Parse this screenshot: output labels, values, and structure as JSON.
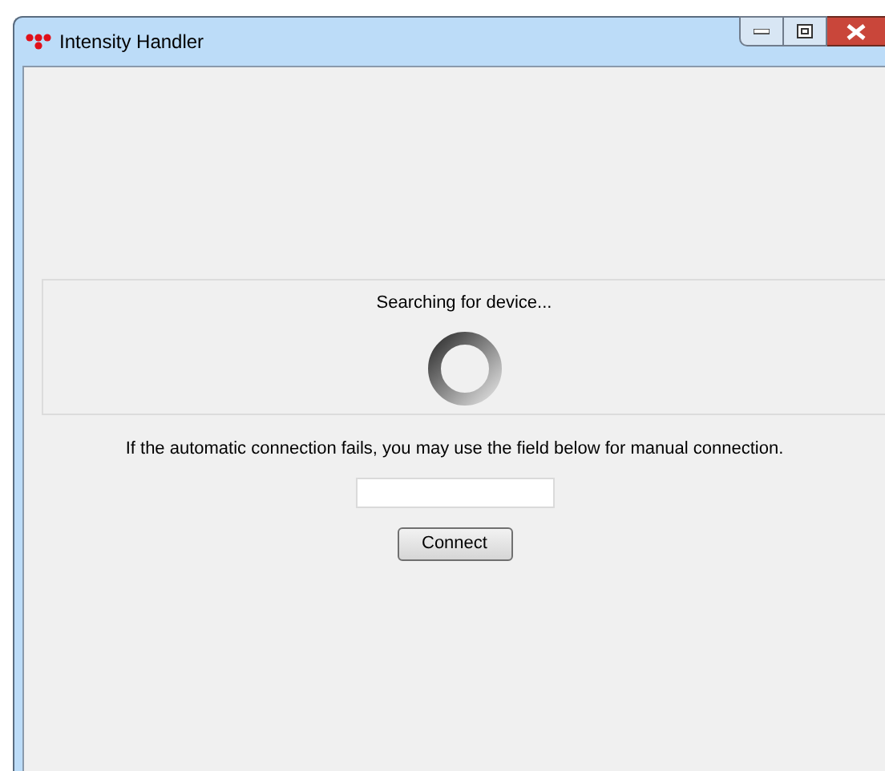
{
  "window": {
    "title": "Intensity Handler"
  },
  "status": {
    "text": "Searching for device..."
  },
  "manual": {
    "hint": "If the automatic connection fails, you may use the field below for manual connection."
  },
  "buttons": [
    "Connect"
  ]
}
